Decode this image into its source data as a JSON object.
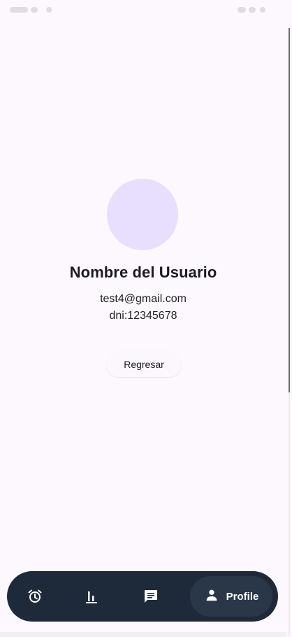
{
  "profile": {
    "name": "Nombre del Usuario",
    "email": "test4@gmail.com",
    "dni": "dni:12345678",
    "back_button_label": "Regresar"
  },
  "bottom_nav": {
    "items": [
      {
        "icon": "alarm-icon"
      },
      {
        "icon": "bar-chart-icon"
      },
      {
        "icon": "chat-icon"
      },
      {
        "icon": "person-icon",
        "label": "Profile",
        "selected": true
      }
    ]
  },
  "colors": {
    "background": "#fcf8fd",
    "avatar": "#e8defd",
    "nav_background": "#1e2a3a",
    "nav_selected": "#2a3748"
  }
}
